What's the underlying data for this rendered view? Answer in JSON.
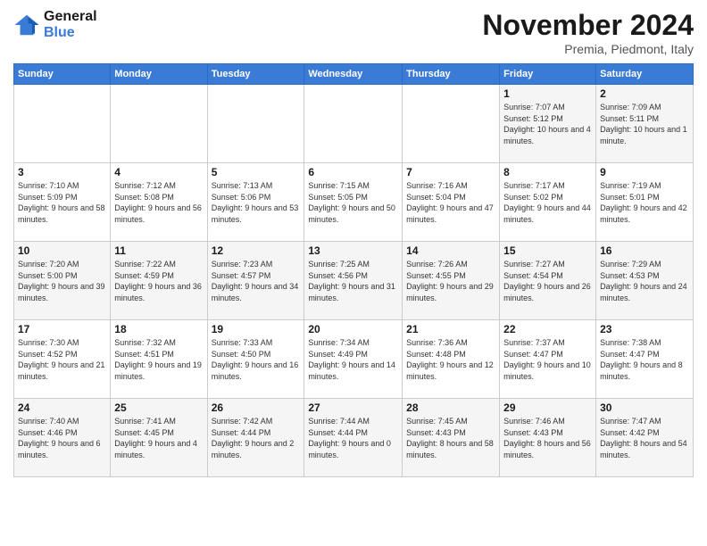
{
  "header": {
    "logo_line1": "General",
    "logo_line2": "Blue",
    "month": "November 2024",
    "location": "Premia, Piedmont, Italy"
  },
  "weekdays": [
    "Sunday",
    "Monday",
    "Tuesday",
    "Wednesday",
    "Thursday",
    "Friday",
    "Saturday"
  ],
  "weeks": [
    [
      {
        "day": "",
        "detail": ""
      },
      {
        "day": "",
        "detail": ""
      },
      {
        "day": "",
        "detail": ""
      },
      {
        "day": "",
        "detail": ""
      },
      {
        "day": "",
        "detail": ""
      },
      {
        "day": "1",
        "detail": "Sunrise: 7:07 AM\nSunset: 5:12 PM\nDaylight: 10 hours and 4 minutes."
      },
      {
        "day": "2",
        "detail": "Sunrise: 7:09 AM\nSunset: 5:11 PM\nDaylight: 10 hours and 1 minute."
      }
    ],
    [
      {
        "day": "3",
        "detail": "Sunrise: 7:10 AM\nSunset: 5:09 PM\nDaylight: 9 hours and 58 minutes."
      },
      {
        "day": "4",
        "detail": "Sunrise: 7:12 AM\nSunset: 5:08 PM\nDaylight: 9 hours and 56 minutes."
      },
      {
        "day": "5",
        "detail": "Sunrise: 7:13 AM\nSunset: 5:06 PM\nDaylight: 9 hours and 53 minutes."
      },
      {
        "day": "6",
        "detail": "Sunrise: 7:15 AM\nSunset: 5:05 PM\nDaylight: 9 hours and 50 minutes."
      },
      {
        "day": "7",
        "detail": "Sunrise: 7:16 AM\nSunset: 5:04 PM\nDaylight: 9 hours and 47 minutes."
      },
      {
        "day": "8",
        "detail": "Sunrise: 7:17 AM\nSunset: 5:02 PM\nDaylight: 9 hours and 44 minutes."
      },
      {
        "day": "9",
        "detail": "Sunrise: 7:19 AM\nSunset: 5:01 PM\nDaylight: 9 hours and 42 minutes."
      }
    ],
    [
      {
        "day": "10",
        "detail": "Sunrise: 7:20 AM\nSunset: 5:00 PM\nDaylight: 9 hours and 39 minutes."
      },
      {
        "day": "11",
        "detail": "Sunrise: 7:22 AM\nSunset: 4:59 PM\nDaylight: 9 hours and 36 minutes."
      },
      {
        "day": "12",
        "detail": "Sunrise: 7:23 AM\nSunset: 4:57 PM\nDaylight: 9 hours and 34 minutes."
      },
      {
        "day": "13",
        "detail": "Sunrise: 7:25 AM\nSunset: 4:56 PM\nDaylight: 9 hours and 31 minutes."
      },
      {
        "day": "14",
        "detail": "Sunrise: 7:26 AM\nSunset: 4:55 PM\nDaylight: 9 hours and 29 minutes."
      },
      {
        "day": "15",
        "detail": "Sunrise: 7:27 AM\nSunset: 4:54 PM\nDaylight: 9 hours and 26 minutes."
      },
      {
        "day": "16",
        "detail": "Sunrise: 7:29 AM\nSunset: 4:53 PM\nDaylight: 9 hours and 24 minutes."
      }
    ],
    [
      {
        "day": "17",
        "detail": "Sunrise: 7:30 AM\nSunset: 4:52 PM\nDaylight: 9 hours and 21 minutes."
      },
      {
        "day": "18",
        "detail": "Sunrise: 7:32 AM\nSunset: 4:51 PM\nDaylight: 9 hours and 19 minutes."
      },
      {
        "day": "19",
        "detail": "Sunrise: 7:33 AM\nSunset: 4:50 PM\nDaylight: 9 hours and 16 minutes."
      },
      {
        "day": "20",
        "detail": "Sunrise: 7:34 AM\nSunset: 4:49 PM\nDaylight: 9 hours and 14 minutes."
      },
      {
        "day": "21",
        "detail": "Sunrise: 7:36 AM\nSunset: 4:48 PM\nDaylight: 9 hours and 12 minutes."
      },
      {
        "day": "22",
        "detail": "Sunrise: 7:37 AM\nSunset: 4:47 PM\nDaylight: 9 hours and 10 minutes."
      },
      {
        "day": "23",
        "detail": "Sunrise: 7:38 AM\nSunset: 4:47 PM\nDaylight: 9 hours and 8 minutes."
      }
    ],
    [
      {
        "day": "24",
        "detail": "Sunrise: 7:40 AM\nSunset: 4:46 PM\nDaylight: 9 hours and 6 minutes."
      },
      {
        "day": "25",
        "detail": "Sunrise: 7:41 AM\nSunset: 4:45 PM\nDaylight: 9 hours and 4 minutes."
      },
      {
        "day": "26",
        "detail": "Sunrise: 7:42 AM\nSunset: 4:44 PM\nDaylight: 9 hours and 2 minutes."
      },
      {
        "day": "27",
        "detail": "Sunrise: 7:44 AM\nSunset: 4:44 PM\nDaylight: 9 hours and 0 minutes."
      },
      {
        "day": "28",
        "detail": "Sunrise: 7:45 AM\nSunset: 4:43 PM\nDaylight: 8 hours and 58 minutes."
      },
      {
        "day": "29",
        "detail": "Sunrise: 7:46 AM\nSunset: 4:43 PM\nDaylight: 8 hours and 56 minutes."
      },
      {
        "day": "30",
        "detail": "Sunrise: 7:47 AM\nSunset: 4:42 PM\nDaylight: 8 hours and 54 minutes."
      }
    ]
  ]
}
